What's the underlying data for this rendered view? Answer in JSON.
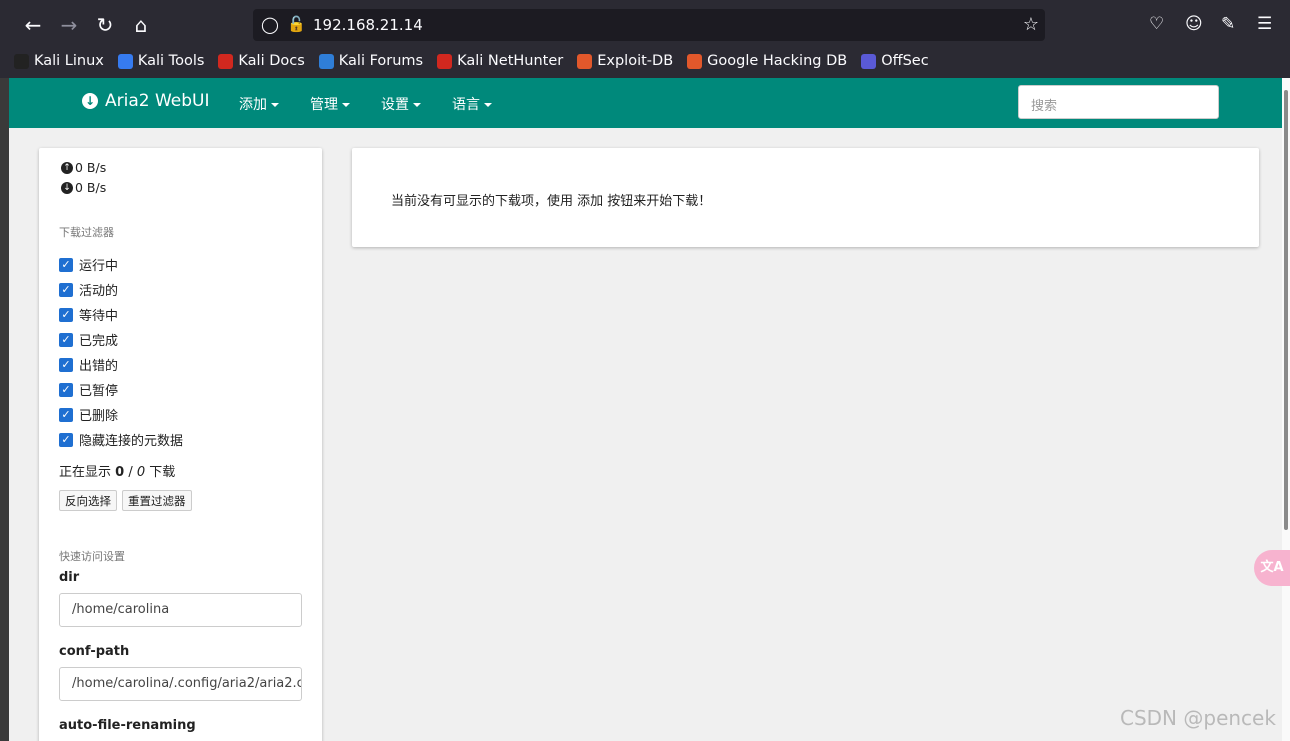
{
  "browser": {
    "url": "192.168.21.14",
    "bookmarks": [
      {
        "label": "Kali Linux",
        "icon": "kali-dragon-icon",
        "color": "#222222"
      },
      {
        "label": "Kali Tools",
        "icon": "kali-tools-icon",
        "color": "#367bf0"
      },
      {
        "label": "Kali Docs",
        "icon": "kali-docs-icon",
        "color": "#d1281f"
      },
      {
        "label": "Kali Forums",
        "icon": "kali-forums-icon",
        "color": "#2f7ed8"
      },
      {
        "label": "Kali NetHunter",
        "icon": "nethunter-icon",
        "color": "#d1281f"
      },
      {
        "label": "Exploit-DB",
        "icon": "exploit-db-icon",
        "color": "#e2582b"
      },
      {
        "label": "Google Hacking DB",
        "icon": "ghdb-icon",
        "color": "#e2582b"
      },
      {
        "label": "OffSec",
        "icon": "offsec-icon",
        "color": "#5a5ad6"
      }
    ]
  },
  "app": {
    "brand": "Aria2 WebUI",
    "menus": [
      "添加",
      "管理",
      "设置",
      "语言"
    ],
    "search_placeholder": "搜索",
    "accent_color": "#00897b"
  },
  "sidebar": {
    "upload_speed": "0 B/s",
    "download_speed": "0 B/s",
    "filter_title": "下载过滤器",
    "filters": [
      {
        "label": "运行中",
        "checked": true
      },
      {
        "label": "活动的",
        "checked": true
      },
      {
        "label": "等待中",
        "checked": true
      },
      {
        "label": "已完成",
        "checked": true
      },
      {
        "label": "出错的",
        "checked": true
      },
      {
        "label": "已暂停",
        "checked": true
      },
      {
        "label": "已删除",
        "checked": true
      },
      {
        "label": "隐藏连接的元数据",
        "checked": true
      }
    ],
    "showing_prefix": "正在显示 ",
    "showing_count": "0",
    "showing_sep": " / ",
    "showing_total": "0",
    "showing_suffix": " 下载",
    "invert_button": "反向选择",
    "reset_button": "重置过滤器",
    "quick_settings_title": "快速访问设置",
    "options": [
      {
        "name": "dir",
        "value": "/home/carolina"
      },
      {
        "name": "conf-path",
        "value": "/home/carolina/.config/aria2/aria2.c"
      },
      {
        "name": "auto-file-renaming",
        "value": ""
      }
    ]
  },
  "main": {
    "empty_message": "当前没有可显示的下载项，使用 添加 按钮来开始下载！"
  },
  "overlay": {
    "translate_label": "文A",
    "watermark": "CSDN @pencek"
  }
}
